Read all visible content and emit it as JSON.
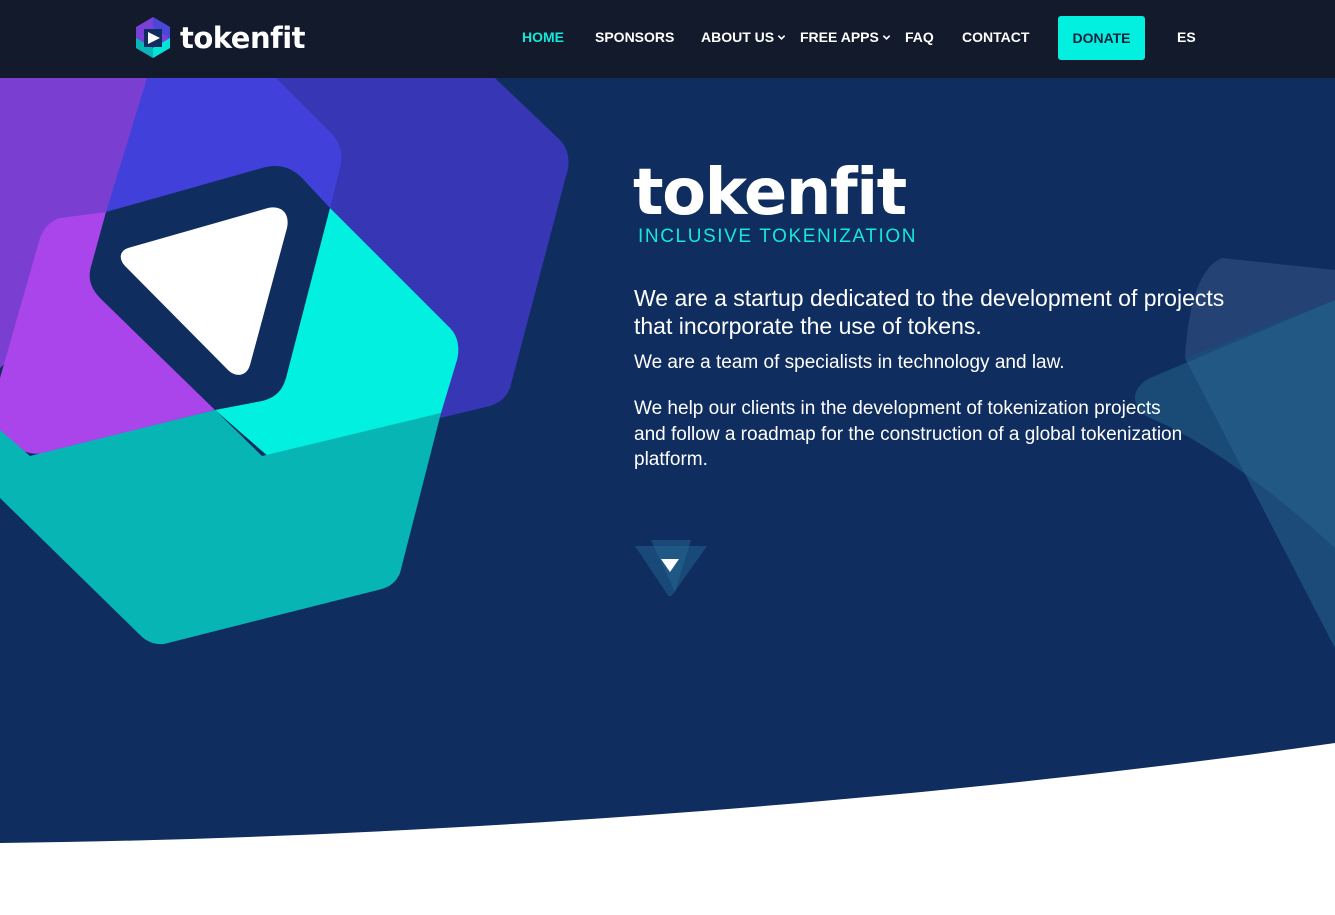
{
  "header": {
    "brand": "tokenfit",
    "nav": [
      {
        "label": "HOME",
        "active": true,
        "dropdown": false
      },
      {
        "label": "SPONSORS",
        "active": false,
        "dropdown": false
      },
      {
        "label": "ABOUT US",
        "active": false,
        "dropdown": true
      },
      {
        "label": "FREE APPS",
        "active": false,
        "dropdown": true
      },
      {
        "label": "FAQ",
        "active": false,
        "dropdown": false
      },
      {
        "label": "CONTACT",
        "active": false,
        "dropdown": false
      }
    ],
    "donate_label": "DONATE",
    "language_label": "ES"
  },
  "hero": {
    "logo_text": "tokenfit",
    "tagline": "INCLUSIVE TOKENIZATION",
    "lead": "We are a startup dedicated to the development of projects that incorporate the use of tokens.",
    "paragraph1": "We are a team of specialists in technology and law.",
    "paragraph2": "We help our clients in the development of tokenization projects and follow a roadmap for the construction of a global tokenization platform.",
    "scroll_icon": "chevron-down-triangle-icon"
  },
  "colors": {
    "navbar": "#121a2b",
    "hero": "#0f2d5e",
    "accent": "#02f0df",
    "purple": "#a945ea",
    "indigo": "#4240da",
    "teal": "#08b5b5"
  }
}
